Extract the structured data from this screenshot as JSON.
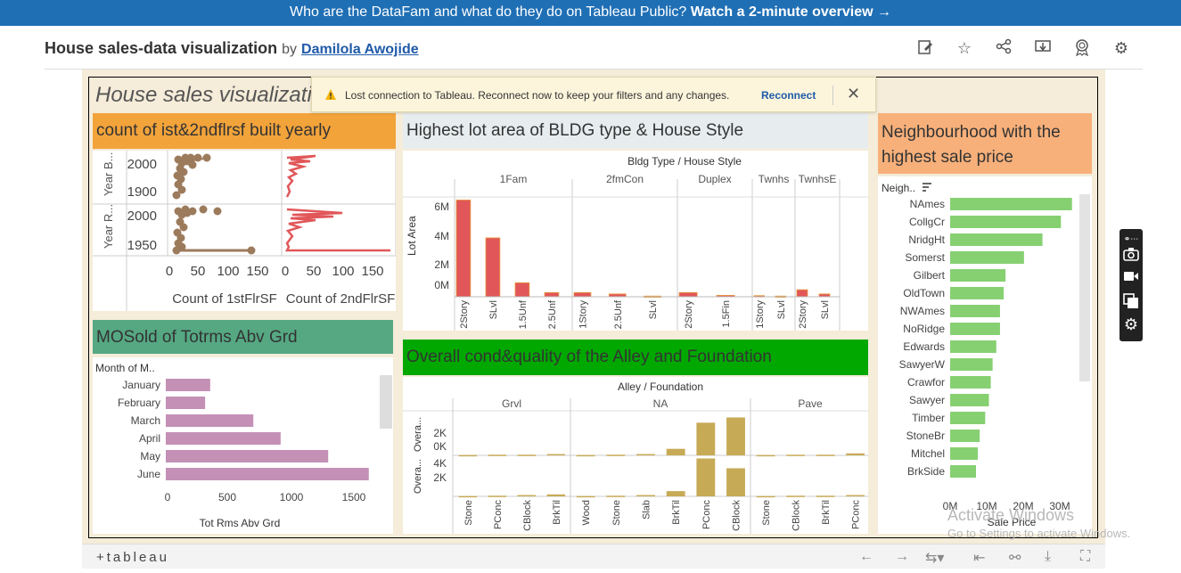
{
  "banner": {
    "text": "Who are the DataFam and what do they do on Tableau Public?",
    "link": "Watch a 2-minute overview →"
  },
  "header": {
    "title": "House sales-data visualization",
    "by": "by",
    "author": "Damilola Awojide",
    "icons": [
      "edit-icon",
      "star-icon",
      "share-icon",
      "download-icon",
      "badge-icon",
      "settings-icon"
    ]
  },
  "dashboard": {
    "title": "House sales visualization"
  },
  "alert": {
    "message": "Lost connection to Tableau. Reconnect now to keep your filters and any changes.",
    "action": "Reconnect",
    "close": "✕"
  },
  "footer": {
    "logo": "+tableau"
  },
  "watermark": {
    "line1": "Activate Windows",
    "line2": "Go to Settings to activate Windows."
  },
  "colors": {
    "banner": "#1f6fb5",
    "orange": "#f2a33a",
    "gray": "#e7edef",
    "salmon": "#f7b07a",
    "teal": "#55a882",
    "green": "#00a800",
    "red": "#e15759",
    "brown": "#9c7b5c",
    "mauve": "#c490b6",
    "olive": "#c7aa56",
    "lightgreen": "#86d072"
  },
  "panels": {
    "p1": {
      "title": "count of ist&2ndflrsf built yearly"
    },
    "p2": {
      "title": "Highest lot area of BLDG type & House Style"
    },
    "p3": {
      "title": "Neighbourhood with the highest sale price"
    },
    "p4": {
      "title": "MOSold of Totrms Abv Grd"
    },
    "p5": {
      "title": "Overall cond&quality of the Alley and Foundation"
    }
  },
  "chart_data": [
    {
      "id": "p1",
      "type": "scatter",
      "row_labels": [
        "Year B...",
        "Year R..."
      ],
      "columns": [
        "Count of 1stFlrSF",
        "Count of 2ndFlrSF"
      ],
      "y_ticks": [
        [
          "2000",
          "1900"
        ],
        [
          "2000",
          "1950"
        ]
      ],
      "x_ticks": [
        "0",
        "50",
        "100",
        "150"
      ],
      "series": [
        {
          "name": "Count of 1stFlrSF",
          "color": "#9c7b5c"
        },
        {
          "name": "Count of 2ndFlrSF",
          "color": "#e15759"
        }
      ]
    },
    {
      "id": "p2",
      "type": "bar",
      "header": "Bldg Type / House Style",
      "groups": [
        {
          "name": "1Fam",
          "styles": [
            "2Story",
            "SLvl",
            "1.5Unf",
            "2.5Unf"
          ],
          "values": [
            6.9,
            4.2,
            1.0,
            0.3
          ]
        },
        {
          "name": "2fmCon",
          "styles": [
            "1Story",
            "2.5Unf",
            "SLvl"
          ],
          "values": [
            0.3,
            0.2,
            0.05
          ]
        },
        {
          "name": "Duplex",
          "styles": [
            "2Story",
            "1.5Fin"
          ],
          "values": [
            0.3,
            0.1
          ]
        },
        {
          "name": "Twnhs",
          "styles": [
            "1Story",
            "SLvl"
          ],
          "values": [
            0.08,
            0.05
          ]
        },
        {
          "name": "TwnhsE",
          "styles": [
            "2Story",
            "SLvl"
          ],
          "values": [
            0.5,
            0.2
          ]
        }
      ],
      "ylabel": "Lot Area",
      "yticks": [
        "6M",
        "4M",
        "2M",
        "0M"
      ],
      "ylim": [
        0,
        7.5
      ]
    },
    {
      "id": "p3",
      "type": "bar",
      "orientation": "horizontal",
      "dim_label": "Neigh..",
      "xlabel": "Sale Price",
      "categories": [
        "NAmes",
        "CollgCr",
        "NridgHt",
        "Somerst",
        "Gilbert",
        "OldTown",
        "NWAmes",
        "NoRidge",
        "Edwards",
        "SawyerW",
        "Crawfor",
        "Sawyer",
        "Timber",
        "StoneBr",
        "Mitchel",
        "BrkSide"
      ],
      "values": [
        33,
        30,
        25,
        20,
        15,
        14.5,
        13.5,
        13.5,
        12.5,
        11.5,
        11,
        10.5,
        9.5,
        8,
        7.5,
        7
      ],
      "xticks": [
        "0M",
        "10M",
        "20M",
        "30M"
      ],
      "xlim": [
        0,
        35
      ]
    },
    {
      "id": "p4",
      "type": "bar",
      "orientation": "horizontal",
      "dim_label": "Month of M..",
      "xlabel": "Tot Rms Abv Grd",
      "categories": [
        "January",
        "February",
        "March",
        "April",
        "May",
        "June"
      ],
      "values": [
        350,
        310,
        690,
        905,
        1280,
        1600
      ],
      "xticks": [
        "0",
        "500",
        "1000",
        "1500"
      ],
      "xlim": [
        0,
        1700
      ]
    },
    {
      "id": "p5",
      "type": "bar",
      "header": "Alley / Foundation",
      "groups": [
        {
          "name": "Grvl",
          "foundations": [
            "Stone",
            "PConc",
            "CBlock",
            "BrkTil"
          ],
          "top": [
            0.05,
            0.1,
            0.1,
            0.2
          ],
          "bottom": [
            0.05,
            0.1,
            0.2,
            0.3
          ]
        },
        {
          "name": "NA",
          "foundations": [
            "Wood",
            "Stone",
            "Slab",
            "BrkTil",
            "PConc",
            "CBlock"
          ],
          "top": [
            0.05,
            0.1,
            0.2,
            1.0,
            5.0,
            5.8
          ],
          "bottom": [
            0.05,
            0.1,
            0.2,
            0.8,
            5.8,
            4.3
          ]
        },
        {
          "name": "Pave",
          "foundations": [
            "Stone",
            "CBlock",
            "BrkTil",
            "PConc"
          ],
          "top": [
            0.05,
            0.1,
            0.1,
            0.3
          ],
          "bottom": [
            0.05,
            0.1,
            0.1,
            0.2
          ]
        }
      ],
      "rows": [
        "Overa...",
        "Overa..."
      ],
      "yticks_top": [
        "2K",
        "0K"
      ],
      "yticks_bottom": [
        "4K",
        "2K"
      ]
    }
  ]
}
